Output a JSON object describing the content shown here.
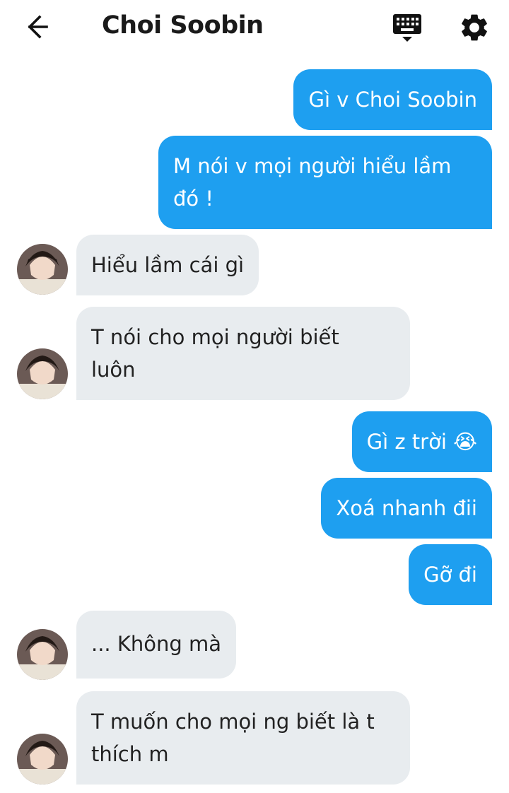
{
  "header": {
    "title": "Choi Soobin",
    "back_icon": "arrow-left-icon",
    "keyboard_icon": "keyboard-icon",
    "settings_icon": "gear-icon"
  },
  "colors": {
    "sent_bubble": "#1e9ff0",
    "received_bubble": "#e8ecef"
  },
  "messages": [
    {
      "side": "sent",
      "text": "Gì v Choi Soobin"
    },
    {
      "side": "sent",
      "text": "M nói v mọi người hiểu lầm\nđó !"
    },
    {
      "side": "received",
      "text": "Hiểu lầm cái gì"
    },
    {
      "side": "received",
      "text": "T nói cho mọi người biết\nluôn"
    },
    {
      "side": "sent",
      "text": "Gì z trời 😭"
    },
    {
      "side": "sent",
      "text": "Xoá nhanh đii"
    },
    {
      "side": "sent",
      "text": "Gỡ đi"
    },
    {
      "side": "received",
      "text": "... Không mà"
    },
    {
      "side": "received",
      "text": "T muốn cho mọi ng biết là t\nthích m"
    }
  ]
}
